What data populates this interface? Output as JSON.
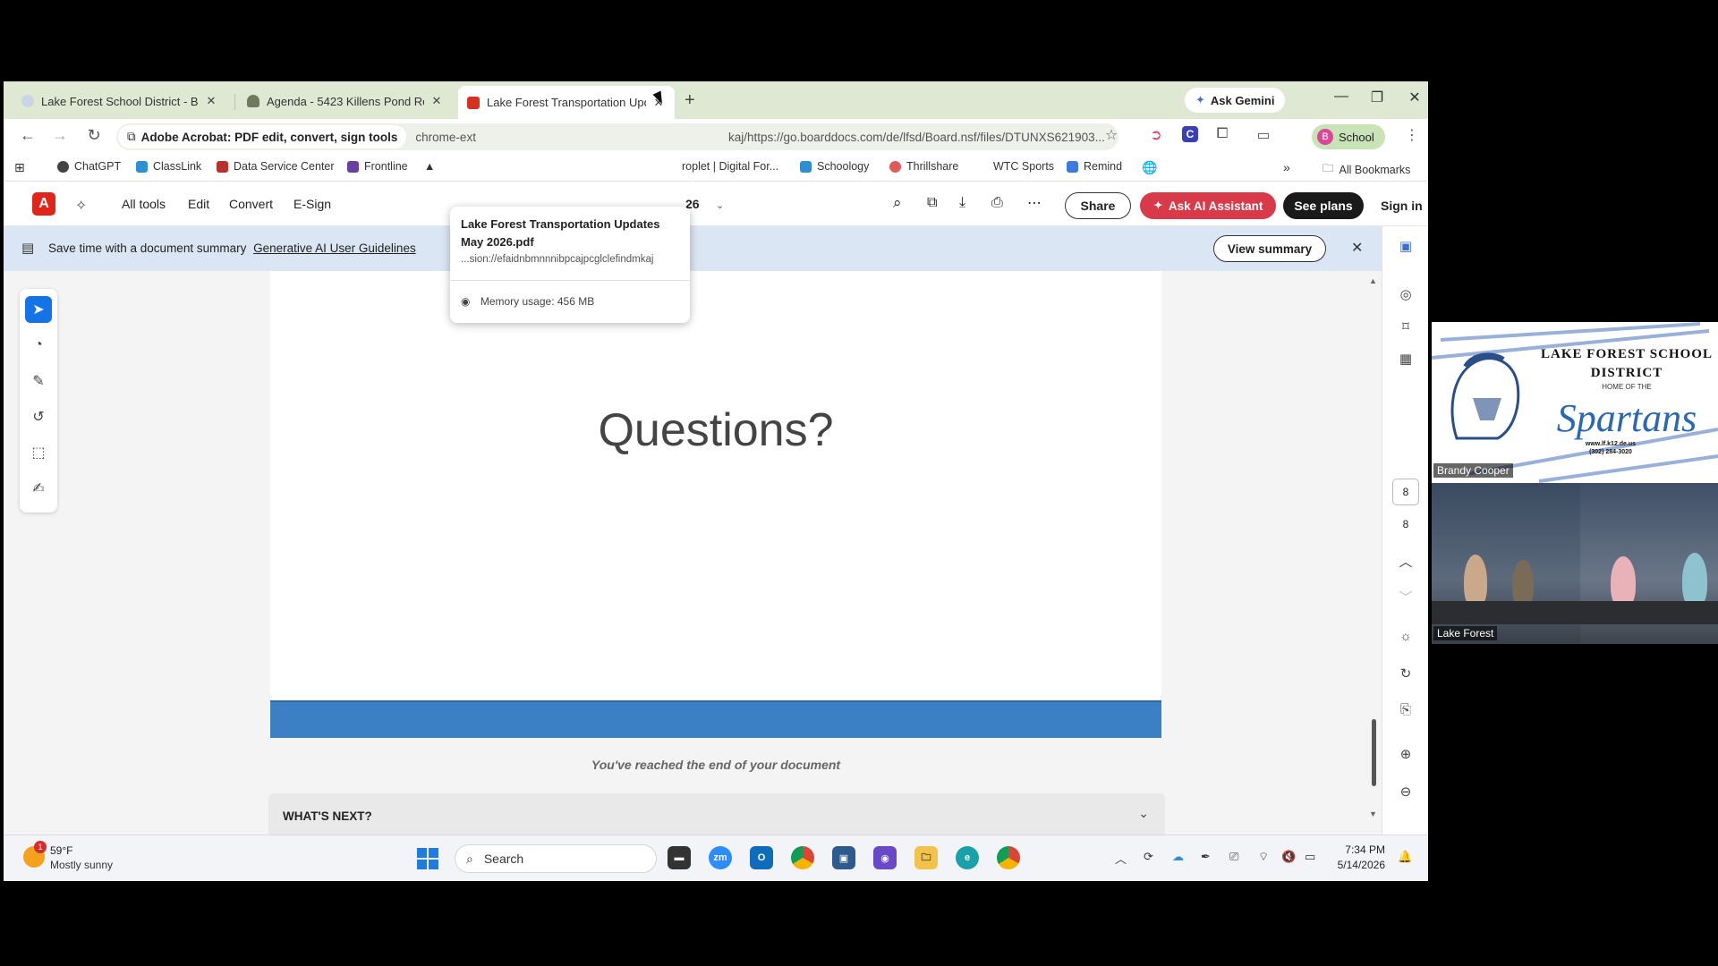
{
  "tabs": [
    {
      "title": "Lake Forest School District - Bo",
      "close": "✕"
    },
    {
      "title": "Agenda - 5423 Killens Pond Ro",
      "close": "✕"
    },
    {
      "title": "Lake Forest Transportation Upd",
      "close": "✕"
    }
  ],
  "tab_new": "+",
  "gemini": {
    "label": "Ask Gemini"
  },
  "window": {
    "minimize": "—",
    "restore": "❐",
    "close": "✕"
  },
  "toolbar": {
    "back": "←",
    "forward": "→",
    "reload": "↻",
    "extension_chip": "Adobe Acrobat: PDF edit, convert, sign tools",
    "url_left": "chrome-ext",
    "url_right": "kaj/https://go.boarddocs.com/de/lfsd/Board.nsf/files/DTUNXS621903...",
    "menu": "⋮"
  },
  "profile": {
    "initial": "B",
    "label": "School"
  },
  "bookmarks": [
    {
      "label": "ChatGPT",
      "color": "#444444"
    },
    {
      "label": "ClassLink",
      "color": "#2d8fd6"
    },
    {
      "label": "Data Service Center",
      "color": "#b8312f"
    },
    {
      "label": "Frontline",
      "color": "#6b3fa0"
    },
    {
      "label": "roplet | Digital For...",
      "color": "#e07b24"
    },
    {
      "label": "Schoology",
      "color": "#2f8ecf"
    },
    {
      "label": "Thrillshare",
      "color": "#e05a5a"
    },
    {
      "label": "WTC Sports",
      "color": "#ffffff"
    },
    {
      "label": "Remind",
      "color": "#3d7be0"
    }
  ],
  "bookmarks_more": "»",
  "all_bookmarks": "All Bookmarks",
  "acrobat": {
    "menu": [
      "All tools",
      "Edit",
      "Convert",
      "E-Sign"
    ],
    "page_fragment": "26",
    "share": "Share",
    "ai_assistant": "Ask AI Assistant",
    "see_plans": "See plans",
    "sign_in": "Sign in"
  },
  "banner": {
    "text": "Save time with a document summary",
    "link": "Generative AI User Guidelines",
    "view_summary": "View summary",
    "close": "✕"
  },
  "document": {
    "slide_title": "Questions?",
    "end_message": "You've reached the end of your document",
    "next_title": "WHAT'S NEXT?"
  },
  "page_nav": {
    "current": "8",
    "total": "8"
  },
  "hover_card": {
    "title": "Lake Forest Transportation Updates May 2026.pdf",
    "url": "...sion://efaidnbmnnnibpcajpcglclefindmkaj",
    "memory": "Memory usage: 456 MB"
  },
  "taskbar": {
    "weather_badge": "1",
    "temp": "59°F",
    "condition": "Mostly sunny",
    "search": "Search",
    "time": "7:34 PM",
    "date": "5/14/2026"
  },
  "video": {
    "district": "LAKE FOREST SCHOOL DISTRICT",
    "home_of": "HOME OF THE",
    "mascot": "Spartans",
    "website": "www.lf.k12.de.us",
    "phone": "(302) 284-3020",
    "speaker_top": "Brandy Cooper",
    "speaker_bottom": "Lake Forest"
  },
  "colors": {
    "tabstrip": "#dfe8d2",
    "acrobat_red": "#e1251b",
    "ai_button": "#d93a4a",
    "banner": "#dbe6f4",
    "slide_bar": "#3b7fc4",
    "spartans_blue": "#2a68b5"
  }
}
